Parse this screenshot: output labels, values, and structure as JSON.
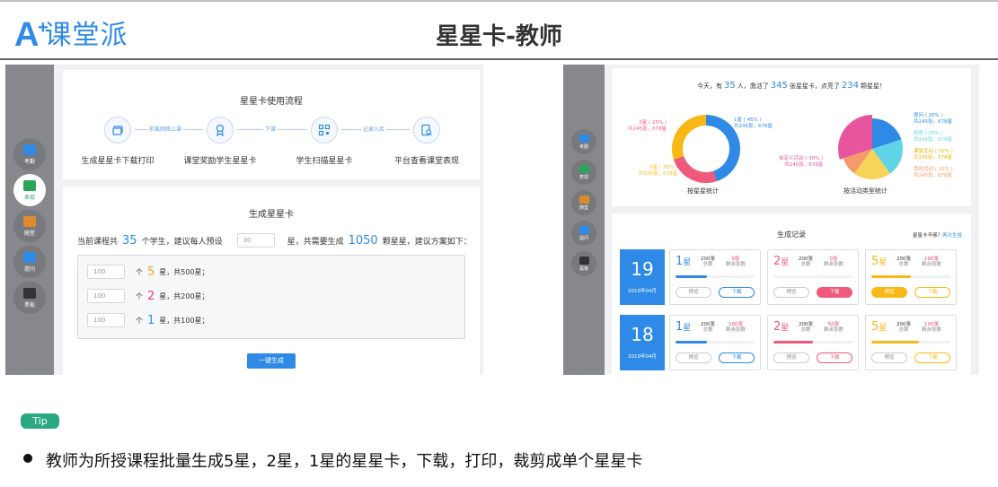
{
  "header": {
    "logo_mark": "A",
    "logo_plus": "+",
    "logo_text": "课堂派",
    "title": "星星卡-教师"
  },
  "left": {
    "sidebar": [
      {
        "label": "考勤",
        "icon": "check-icon",
        "active": false
      },
      {
        "label": "表现",
        "icon": "trophy-icon",
        "active": true
      },
      {
        "label": "随堂",
        "icon": "cake-icon",
        "active": false
      },
      {
        "label": "提问",
        "icon": "question-icon",
        "active": false
      },
      {
        "label": "黑板",
        "icon": "board-icon",
        "active": false
      }
    ],
    "flow": {
      "title": "星星卡使用流程",
      "steps": [
        "生成星星卡下载打印",
        "课堂奖励学生星星卡",
        "学生扫描星星卡",
        "平台查看课堂表现"
      ],
      "connectors": [
        "前离网络上课",
        "下课",
        "记录入库"
      ]
    },
    "generate": {
      "title": "生成星星卡",
      "prefix": "当前课程共",
      "students": "35",
      "mid1": "个学生，建议每人预设",
      "per_student": "30",
      "mid2": "星，共需要生成",
      "total": "1050",
      "suffix": "颗星星，建议方案如下：",
      "rows": [
        {
          "count": "100",
          "pre": "个",
          "stars": "5",
          "post": "星，共500星；",
          "color": "#f5a623"
        },
        {
          "count": "100",
          "pre": "个",
          "stars": "2",
          "post": "星，共200星；",
          "color": "#e8427c"
        },
        {
          "count": "100",
          "pre": "个",
          "stars": "1",
          "post": "星，共100星；",
          "color": "#2e8ae6"
        }
      ],
      "button": "一键生成"
    }
  },
  "right": {
    "sidebar": [
      {
        "label": "考勤",
        "icon": "check-icon"
      },
      {
        "label": "表现",
        "icon": "trophy-icon"
      },
      {
        "label": "随堂",
        "icon": "cake-icon"
      },
      {
        "label": "提问",
        "icon": "question-icon"
      },
      {
        "label": "黑板",
        "icon": "board-icon"
      }
    ],
    "summary": {
      "p1": "今天，有",
      "people": "35",
      "p2": "人，激活了",
      "activated": "345",
      "p3": "张星星卡，点亮了",
      "lit": "234",
      "p4": "颗星星！"
    },
    "chart_data": [
      {
        "type": "pie",
        "title": "按星星统计",
        "labels": [
          "1星 ( 45% )",
          "2星 ( 25% )",
          "5星 ( 30% )"
        ],
        "sublabels": [
          "共245张，678星",
          "共245张，678星",
          "共245张，678星"
        ],
        "values": [
          45,
          25,
          30
        ],
        "colors": [
          "#2e8ae6",
          "#ef5a7c",
          "#f8b916"
        ],
        "donut": true
      },
      {
        "type": "pie",
        "title": "按活动类型统计",
        "labels": [
          "提问 ( 20% )",
          "抢答 ( 20% )",
          "课堂互动 ( 20% )",
          "其他活动 ( 10% )",
          "自定义活动 ( 30% )"
        ],
        "sublabels": [
          "共245张，678星",
          "共245张，678星",
          "共245张，678星",
          "共245张，678星",
          "共245张，678星"
        ],
        "values": [
          20,
          20,
          20,
          10,
          30
        ],
        "colors": [
          "#2e8ae6",
          "#5fd3e8",
          "#f8d35a",
          "#f59a6a",
          "#e7559f"
        ],
        "donut": false
      }
    ],
    "records": {
      "title": "生成记录",
      "link_pre": "星星卡不够？",
      "link": "再次生成",
      "preview": "预览",
      "download": "下载",
      "total_lbl": "总数",
      "remain_lbl": "剩余张数",
      "groups": [
        {
          "day": "19",
          "month": "2019年04月",
          "cards": [
            {
              "star": "1",
              "total": "200张",
              "remain": "0张",
              "color": "#2e8ae6",
              "progress": 0.4,
              "hl": "none"
            },
            {
              "star": "2",
              "total": "200张",
              "remain": "0张",
              "color": "#ef5a7c",
              "progress": 0.0,
              "hl": "download"
            },
            {
              "star": "5",
              "total": "200张",
              "remain": "100张",
              "color": "#f8b916",
              "progress": 0.5,
              "hl": "preview"
            }
          ]
        },
        {
          "day": "18",
          "month": "2019年04月",
          "cards": [
            {
              "star": "1",
              "total": "200张",
              "remain": "100张",
              "color": "#2e8ae6",
              "progress": 0.4,
              "hl": "none"
            },
            {
              "star": "2",
              "total": "200张",
              "remain": "50张",
              "color": "#ef5a7c",
              "progress": 0.5,
              "hl": "none"
            },
            {
              "star": "5",
              "total": "200张",
              "remain": "100张",
              "color": "#f8b916",
              "progress": 0.6,
              "hl": "none"
            }
          ]
        }
      ]
    }
  },
  "tip": "Tip",
  "note": "教师为所授课程批量生成5星，2星，1星的星星卡，下载，打印，裁剪成单个星星卡"
}
